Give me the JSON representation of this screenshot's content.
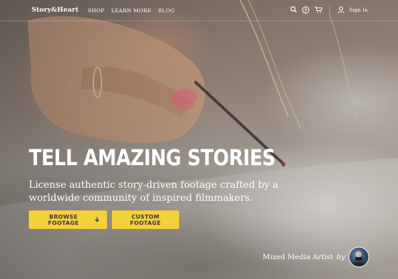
{
  "header": {
    "logo": "Story&Heart",
    "nav": [
      "SHOP",
      "LEARN MORE",
      "BLOG"
    ],
    "icons": [
      "search-icon",
      "help-icon",
      "cart-icon",
      "user-icon"
    ],
    "signin_label": "Sign In"
  },
  "hero": {
    "headline": "TELL AMAZING STORIES",
    "subhead": "License authentic story-driven footage crafted by a worldwide community of inspired filmmakers.",
    "buttons": {
      "browse": "BROWSE FOOTAGE",
      "browse_icon": "arrow-down-icon",
      "custom": "CUSTOM FOOTAGE"
    },
    "credit": {
      "title": "Mixed Media Artist",
      "by": "by"
    }
  },
  "colors": {
    "accent": "#f4d03a",
    "button_text": "#3a3a3a",
    "text": "#ffffff"
  }
}
